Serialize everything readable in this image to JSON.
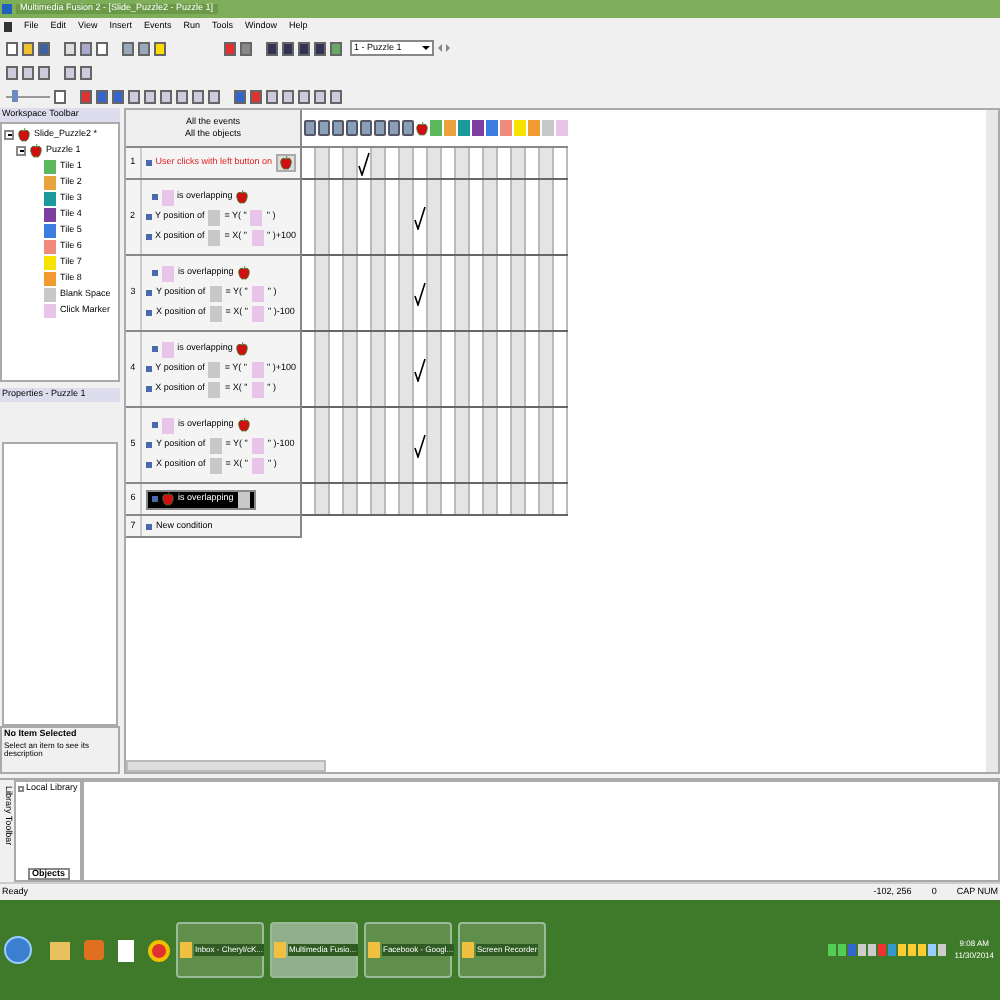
{
  "window": {
    "title": "Multimedia Fusion 2 - [Slide_Puzzle2 - Puzzle 1]"
  },
  "menu": [
    "File",
    "Edit",
    "View",
    "Insert",
    "Events",
    "Run",
    "Tools",
    "Window",
    "Help"
  ],
  "frame_select": {
    "value": "1 - Puzzle 1"
  },
  "zoom_slider": {
    "level": 0.15
  },
  "workspace": {
    "title": "Workspace Toolbar",
    "tree": [
      {
        "label": "Slide_Puzzle2 *",
        "expanded": true,
        "children": [
          {
            "label": "Puzzle 1",
            "expanded": true,
            "children": [
              {
                "label": "Tile 1",
                "color": "#5cb85c"
              },
              {
                "label": "Tile 2",
                "color": "#e8a33c"
              },
              {
                "label": "Tile 3",
                "color": "#1a9a9a"
              },
              {
                "label": "Tile 4",
                "color": "#7b3fa0"
              },
              {
                "label": "Tile 5",
                "color": "#3d7de0"
              },
              {
                "label": "Tile 6",
                "color": "#f08a7a"
              },
              {
                "label": "Tile 7",
                "color": "#f5e400"
              },
              {
                "label": "Tile 8",
                "color": "#f09a30"
              },
              {
                "label": "Blank Space",
                "color": "#c8c8c8"
              },
              {
                "label": "Click Marker",
                "color": "#e8c4e8"
              }
            ]
          }
        ]
      }
    ]
  },
  "properties": {
    "title": "Properties - Puzzle 1",
    "heading": "No Item Selected",
    "description": "Select an item to see its description"
  },
  "events": {
    "header": [
      "All the events",
      "All the objects"
    ],
    "columns": [
      {
        "kind": "system"
      },
      {
        "kind": "system"
      },
      {
        "kind": "system"
      },
      {
        "kind": "system"
      },
      {
        "kind": "system"
      },
      {
        "kind": "system"
      },
      {
        "kind": "system"
      },
      {
        "kind": "system"
      },
      {
        "kind": "apple"
      },
      {
        "kind": "tile",
        "color": "#5cb85c"
      },
      {
        "kind": "tile",
        "color": "#e8a33c"
      },
      {
        "kind": "tile",
        "color": "#1a9a9a"
      },
      {
        "kind": "tile",
        "color": "#7b3fa0"
      },
      {
        "kind": "tile",
        "color": "#3d7de0"
      },
      {
        "kind": "tile",
        "color": "#f08a7a"
      },
      {
        "kind": "tile",
        "color": "#f5e400"
      },
      {
        "kind": "tile",
        "color": "#f09a30"
      },
      {
        "kind": "tile",
        "color": "#c8c8c8"
      },
      {
        "kind": "tile",
        "color": "#e8c4e8"
      }
    ],
    "rows": [
      {
        "number": "1",
        "conditions": [
          {
            "kind": "click",
            "text": "User clicks with left button on"
          }
        ],
        "cells": [
          {
            "checked": false
          },
          {
            "checked": false
          },
          {
            "checked": false
          },
          {
            "checked": false
          },
          {
            "checked": true
          },
          {
            "checked": false
          },
          {
            "checked": false
          },
          {
            "checked": false
          },
          {
            "checked": false
          },
          {
            "checked": false
          },
          {
            "checked": false
          },
          {
            "checked": false
          },
          {
            "checked": false
          },
          {
            "checked": false
          },
          {
            "checked": false
          },
          {
            "checked": false
          },
          {
            "checked": false
          },
          {
            "checked": false
          },
          {
            "checked": false
          }
        ]
      },
      {
        "number": "2",
        "conditions": [
          {
            "kind": "overlap",
            "text": "is overlapping",
            "selected": false
          },
          {
            "kind": "position",
            "label": "Y position of",
            "op": "= Y( \"",
            "suffix": "\" )"
          },
          {
            "kind": "position",
            "label": "X position of",
            "op": "= X( \"",
            "suffix": "\" )+100"
          }
        ],
        "cells": [
          {
            "checked": false
          },
          {
            "checked": false
          },
          {
            "checked": false
          },
          {
            "checked": false
          },
          {
            "checked": false
          },
          {
            "checked": false
          },
          {
            "checked": false
          },
          {
            "checked": false
          },
          {
            "checked": true
          },
          {
            "checked": false
          },
          {
            "checked": false
          },
          {
            "checked": false
          },
          {
            "checked": false
          },
          {
            "checked": false
          },
          {
            "checked": false
          },
          {
            "checked": false
          },
          {
            "checked": false
          },
          {
            "checked": false
          },
          {
            "checked": false
          }
        ]
      },
      {
        "number": "3",
        "conditions": [
          {
            "kind": "overlap",
            "text": "is overlapping",
            "selected": false
          },
          {
            "kind": "position",
            "label": "Y position of",
            "op": "= Y( \"",
            "suffix": "\" )"
          },
          {
            "kind": "position",
            "label": "X position of",
            "op": "= X( \"",
            "suffix": "\" )-100"
          }
        ],
        "cells": [
          {
            "checked": false
          },
          {
            "checked": false
          },
          {
            "checked": false
          },
          {
            "checked": false
          },
          {
            "checked": false
          },
          {
            "checked": false
          },
          {
            "checked": false
          },
          {
            "checked": false
          },
          {
            "checked": true
          },
          {
            "checked": false
          },
          {
            "checked": false
          },
          {
            "checked": false
          },
          {
            "checked": false
          },
          {
            "checked": false
          },
          {
            "checked": false
          },
          {
            "checked": false
          },
          {
            "checked": false
          },
          {
            "checked": false
          },
          {
            "checked": false
          }
        ]
      },
      {
        "number": "4",
        "conditions": [
          {
            "kind": "overlap",
            "text": "is overlapping",
            "selected": false
          },
          {
            "kind": "position",
            "label": "Y position of",
            "op": "= Y( \"",
            "suffix": "\" )+100"
          },
          {
            "kind": "position",
            "label": "X position of",
            "op": "= X( \"",
            "suffix": "\" )"
          }
        ],
        "cells": [
          {
            "checked": false
          },
          {
            "checked": false
          },
          {
            "checked": false
          },
          {
            "checked": false
          },
          {
            "checked": false
          },
          {
            "checked": false
          },
          {
            "checked": false
          },
          {
            "checked": false
          },
          {
            "checked": true
          },
          {
            "checked": false
          },
          {
            "checked": false
          },
          {
            "checked": false
          },
          {
            "checked": false
          },
          {
            "checked": false
          },
          {
            "checked": false
          },
          {
            "checked": false
          },
          {
            "checked": false
          },
          {
            "checked": false
          },
          {
            "checked": false
          }
        ]
      },
      {
        "number": "5",
        "conditions": [
          {
            "kind": "overlap",
            "text": "is overlapping",
            "selected": false
          },
          {
            "kind": "position",
            "label": "Y position of",
            "op": "= Y( \"",
            "suffix": "\" )-100"
          },
          {
            "kind": "position",
            "label": "X position of",
            "op": "= X( \"",
            "suffix": "\" )"
          }
        ],
        "cells": [
          {
            "checked": false
          },
          {
            "checked": false
          },
          {
            "checked": false
          },
          {
            "checked": false
          },
          {
            "checked": false
          },
          {
            "checked": false
          },
          {
            "checked": false
          },
          {
            "checked": false
          },
          {
            "checked": true
          },
          {
            "checked": false
          },
          {
            "checked": false
          },
          {
            "checked": false
          },
          {
            "checked": false
          },
          {
            "checked": false
          },
          {
            "checked": false
          },
          {
            "checked": false
          },
          {
            "checked": false
          },
          {
            "checked": false
          },
          {
            "checked": false
          }
        ]
      },
      {
        "number": "6",
        "conditions": [
          {
            "kind": "overlap",
            "text": "is overlapping",
            "selected": true
          }
        ],
        "cells": [
          {
            "checked": false
          },
          {
            "checked": false
          },
          {
            "checked": false
          },
          {
            "checked": false
          },
          {
            "checked": false
          },
          {
            "checked": false
          },
          {
            "checked": false
          },
          {
            "checked": false
          },
          {
            "checked": false
          },
          {
            "checked": false
          },
          {
            "checked": false
          },
          {
            "checked": false
          },
          {
            "checked": false
          },
          {
            "checked": false
          },
          {
            "checked": false
          },
          {
            "checked": false
          },
          {
            "checked": false
          },
          {
            "checked": false
          },
          {
            "checked": false
          }
        ]
      },
      {
        "number": "7",
        "conditions": [
          {
            "kind": "new",
            "text": "New condition"
          }
        ]
      }
    ]
  },
  "library": {
    "title": "Library Toolbar",
    "item": "Local Library",
    "tab": "Objects"
  },
  "status_bar": [
    "Ready",
    "-102, 256",
    "0",
    "CAP NUM"
  ],
  "taskbar": {
    "tasks": [
      {
        "label": "Inbox - Cheryl/cK...",
        "selected": false
      },
      {
        "label": "Multimedia Fusio...",
        "selected": true
      },
      {
        "label": "Facebook - Googl...",
        "selected": false
      },
      {
        "label": "Screen Recorder",
        "selected": false
      }
    ],
    "clock": [
      "9:08 AM",
      "11/30/2014"
    ]
  }
}
